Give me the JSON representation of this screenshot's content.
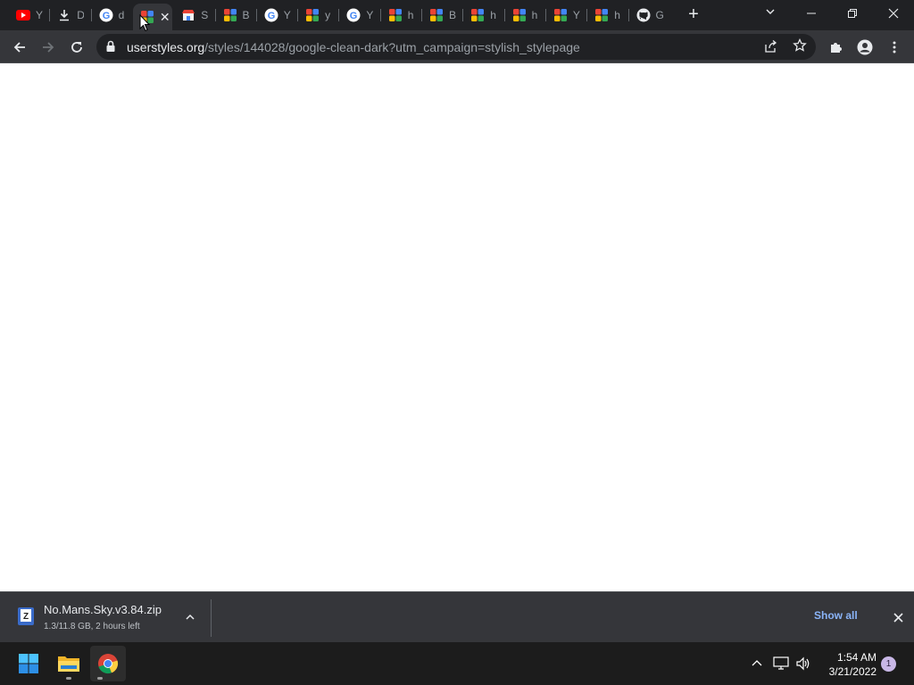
{
  "tabs": [
    {
      "icon": "youtube-icon",
      "title": "Y"
    },
    {
      "icon": "download-icon",
      "title": "D"
    },
    {
      "icon": "google-icon",
      "title": "d"
    },
    {
      "icon": "stylish-icon",
      "title": "",
      "active": true
    },
    {
      "icon": "store-icon",
      "title": "S"
    },
    {
      "icon": "stylish-icon",
      "title": "B"
    },
    {
      "icon": "google-icon",
      "title": "Y"
    },
    {
      "icon": "stylish-icon",
      "title": "y"
    },
    {
      "icon": "google-icon",
      "title": "Y"
    },
    {
      "icon": "stylish-icon",
      "title": "h"
    },
    {
      "icon": "stylish-icon",
      "title": "B"
    },
    {
      "icon": "stylish-icon",
      "title": "h"
    },
    {
      "icon": "stylish-icon",
      "title": "h"
    },
    {
      "icon": "stylish-icon",
      "title": "Y"
    },
    {
      "icon": "stylish-icon",
      "title": "h"
    },
    {
      "icon": "github-icon",
      "title": "G"
    }
  ],
  "address_bar": {
    "host": "userstyles.org",
    "path": "/styles/144028/google-clean-dark?utm_campaign=stylish_stylepage"
  },
  "download": {
    "filename": "No.Mans.Sky.v3.84.zip",
    "status": "1.3/11.8 GB, 2 hours left",
    "show_all": "Show all"
  },
  "taskbar": {
    "time": "1:54 AM",
    "date": "3/21/2022",
    "notification_count": "1"
  },
  "colors": {
    "tabstrip": "#202124",
    "toolbar": "#35363a",
    "link": "#8ab4f8"
  }
}
